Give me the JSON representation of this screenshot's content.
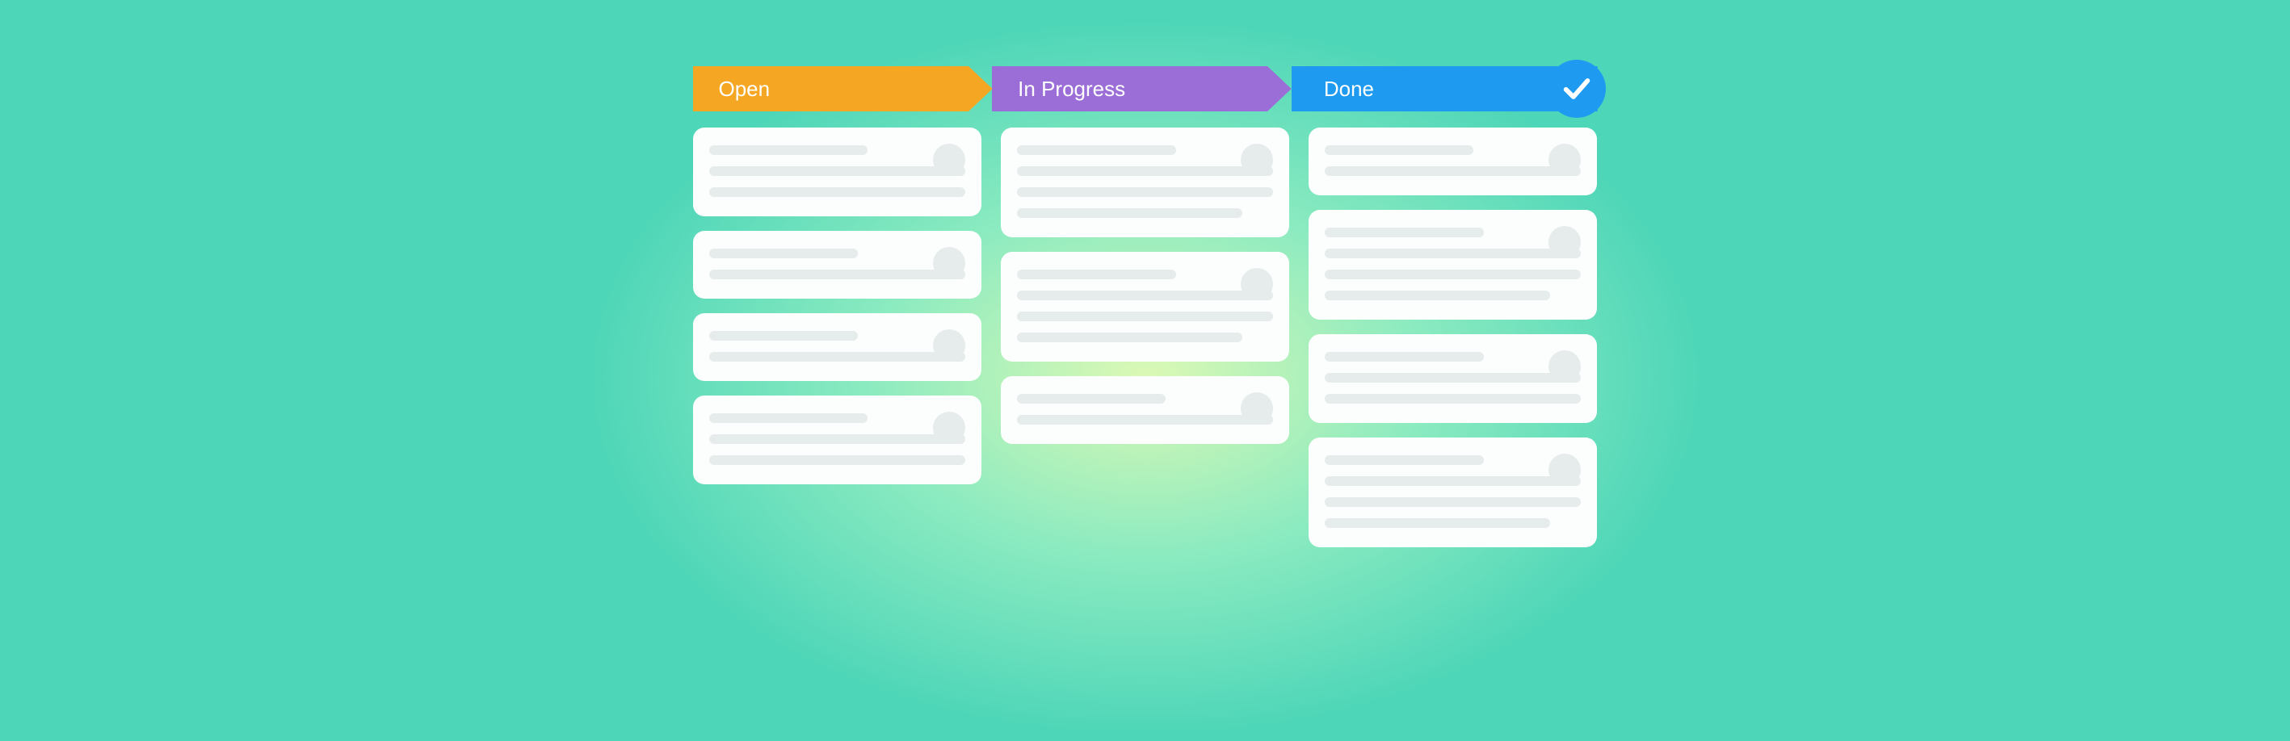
{
  "board": {
    "columns": [
      {
        "key": "open",
        "label": "Open",
        "color": "#f5a623",
        "cards": [
          3,
          2,
          2,
          3
        ]
      },
      {
        "key": "in_progress",
        "label": "In Progress",
        "color": "#9b6dd7",
        "cards": [
          4,
          4,
          2
        ]
      },
      {
        "key": "done",
        "label": "Done",
        "color": "#1e9bf0",
        "cards": [
          2,
          4,
          3,
          4
        ],
        "badge": "checkmark"
      }
    ]
  },
  "colors": {
    "background": "#4dd6b8",
    "card_bg": "#fcfdfd",
    "placeholder": "#e6ecec"
  }
}
